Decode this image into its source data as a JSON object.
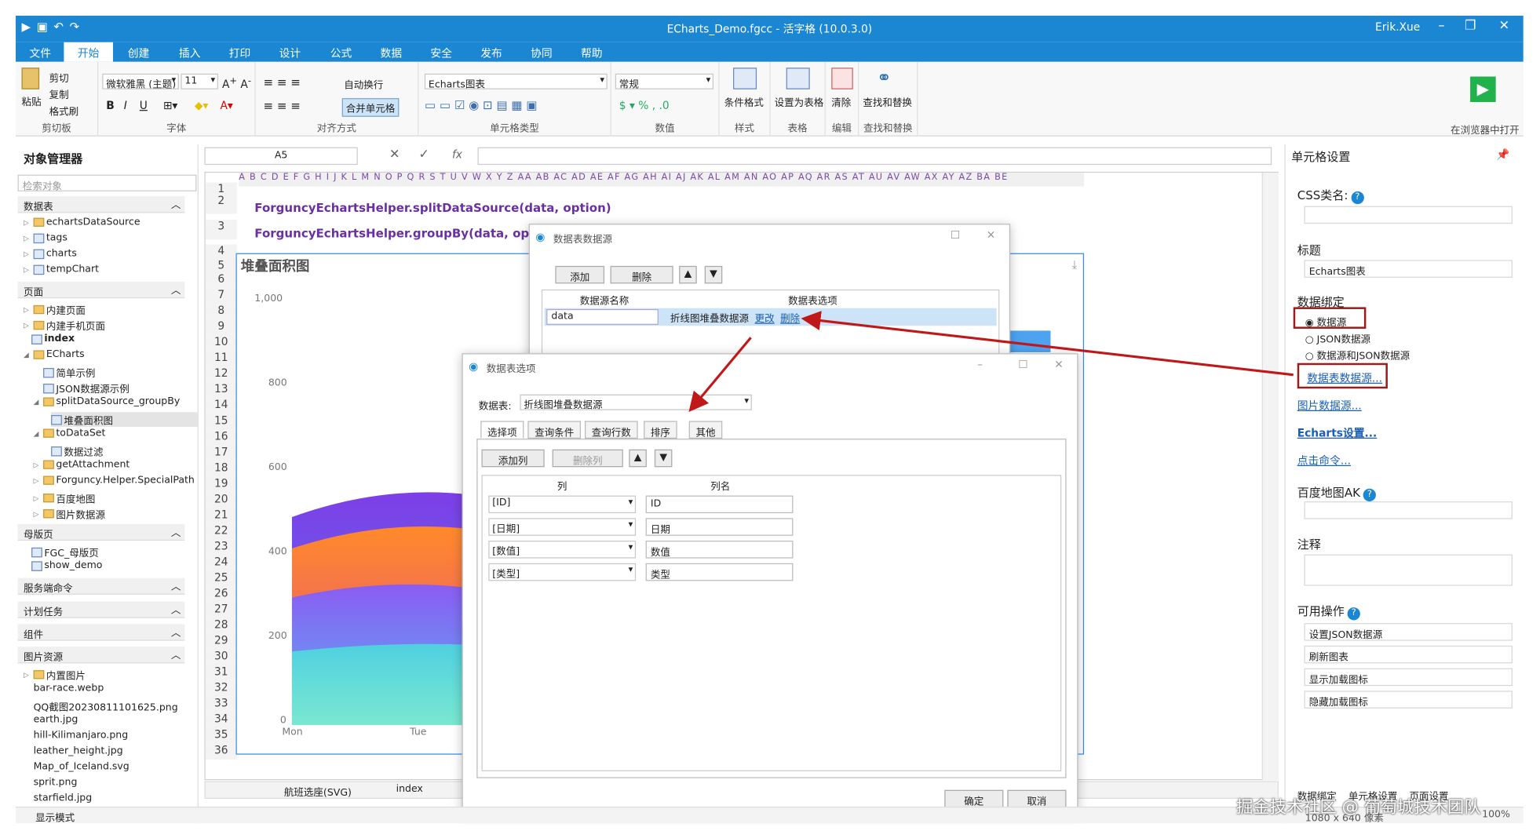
{
  "window": {
    "title": "ECharts_Demo.fgcc - 活字格 (10.0.3.0)",
    "user": "Erik.Xue"
  },
  "menu": [
    "文件",
    "开始",
    "创建",
    "插入",
    "打印",
    "设计",
    "公式",
    "数据",
    "安全",
    "发布",
    "协同",
    "帮助"
  ],
  "ribbon": {
    "paste": "粘贴",
    "cut": "剪切",
    "copy": "复制",
    "format_painter": "格式刷",
    "clipboard": "剪切板",
    "font_name": "微软雅黑 (主题)",
    "font_size": "11",
    "font": "字体",
    "wrap": "自动换行",
    "merge": "合并单元格",
    "alignment": "对齐方式",
    "cell_type_value": "Echarts图表",
    "cell_type": "单元格类型",
    "number_format": "常规",
    "value": "数值",
    "cond_format": "条件格式",
    "style": "样式",
    "set_table": "设置为表格",
    "table": "表格",
    "clear": "清除",
    "edit": "编辑",
    "find_replace": "查找和替换",
    "find_replace_group": "查找和替换",
    "preview": "在浏览器中打开"
  },
  "left_panel": {
    "title": "对象管理器",
    "search_placeholder": "检索对象",
    "sections": {
      "tables": "数据表",
      "pages": "页面",
      "master": "母版页",
      "server": "服务端命令",
      "schedule": "计划任务",
      "components": "组件",
      "images": "图片资源"
    },
    "tables": [
      "echartsDataSource",
      "tags",
      "charts",
      "tempChart"
    ],
    "pages": [
      "内建页面",
      "内建手机页面",
      "index",
      "ECharts",
      "简单示例",
      "JSON数据源示例",
      "splitDataSource_groupBy",
      "堆叠面积图",
      "toDataSet",
      "数据过滤",
      "getAttachment",
      "Forguncy.Helper.SpecialPath",
      "百度地图",
      "图片数据源"
    ],
    "master": [
      "FGC_母版页",
      "show_demo"
    ],
    "images": [
      "内置图片",
      "bar-race.webp",
      "QQ截图20230811101625.png",
      "earth.jpg",
      "hill-Kilimanjaro.png",
      "leather_height.jpg",
      "Map_of_Iceland.svg",
      "sprit.png",
      "starfield.jpg"
    ]
  },
  "formula": {
    "cell_ref": "A5",
    "fx": "fx"
  },
  "sheet": {
    "columns": "A B C D E F G H I J K L M N O P Q R S T U V W X Y Z AA AB AC AD AE AF AG AH AI AJ AK AL AM AN AO AP AQ AR AS AT AU AV AW AX AY AZ BA BE",
    "rows": [
      "1",
      "2",
      "3",
      "4",
      "5",
      "6",
      "7",
      "8",
      "9",
      "10",
      "11",
      "12",
      "13",
      "14",
      "15",
      "16",
      "17",
      "18",
      "19",
      "20",
      "21",
      "22",
      "23",
      "24",
      "25",
      "26",
      "27",
      "28",
      "29",
      "30",
      "31",
      "32",
      "33",
      "34",
      "35",
      "36"
    ],
    "line2": "ForguncyEchartsHelper.splitDataSource(data, option)",
    "line3": "ForguncyEchartsHelper.groupBy(data, option)",
    "tabs": [
      "航班选座(SVG)",
      "index"
    ]
  },
  "chart": {
    "title": "堆叠面积图",
    "y_ticks": [
      "1,000",
      "800",
      "600",
      "400",
      "200",
      "0"
    ],
    "x_ticks": [
      "Mon",
      "Tue"
    ]
  },
  "chart_data": {
    "type": "area",
    "title": "堆叠面积图",
    "categories": [
      "Mon",
      "Tue"
    ],
    "ylim": [
      0,
      1000
    ],
    "grid": false
  },
  "dialog1": {
    "title": "数据表数据源",
    "add": "添加",
    "delete": "删除",
    "col_name": "数据源名称",
    "col_opt": "数据表选项",
    "row_name": "data",
    "row_opt": "折线图堆叠数据源",
    "edit": "更改",
    "remove": "删除"
  },
  "dialog2": {
    "title": "数据表选项",
    "table_label": "数据表:",
    "table_value": "折线图堆叠数据源",
    "tabs": [
      "选择项",
      "查询条件",
      "查询行数",
      "排序",
      "其他"
    ],
    "add_col": "添加列",
    "del_col": "删除列",
    "h_col": "列",
    "h_name": "列名",
    "rows": [
      {
        "col": "[ID]",
        "name": "ID"
      },
      {
        "col": "[日期]",
        "name": "日期"
      },
      {
        "col": "[数值]",
        "name": "数值"
      },
      {
        "col": "[类型]",
        "name": "类型"
      }
    ],
    "ok": "确定",
    "cancel": "取消"
  },
  "right_panel": {
    "title": "单元格设置",
    "css_label": "CSS类名:",
    "title_label": "标题",
    "title_value": "Echarts图表",
    "binding": "数据绑定",
    "opt1": "数据源",
    "opt2": "JSON数据源",
    "opt3": "数据源和JSON数据源",
    "link1": "数据表数据源...",
    "link2": "图片数据源...",
    "link3": "Echarts设置...",
    "link4": "点击命令...",
    "baidu": "百度地图AK",
    "note": "注释",
    "actions": "可用操作",
    "action_items": [
      "设置JSON数据源",
      "刷新图表",
      "显示加载图标",
      "隐藏加载图标"
    ],
    "bottom_tabs": [
      "数据绑定",
      "单元格设置",
      "页面设置"
    ]
  },
  "status": {
    "mode": "显示模式",
    "size": "1080 x 640 像素",
    "zoom": "100%"
  },
  "watermark": "掘金技术社区 @ 葡萄城技术团队"
}
